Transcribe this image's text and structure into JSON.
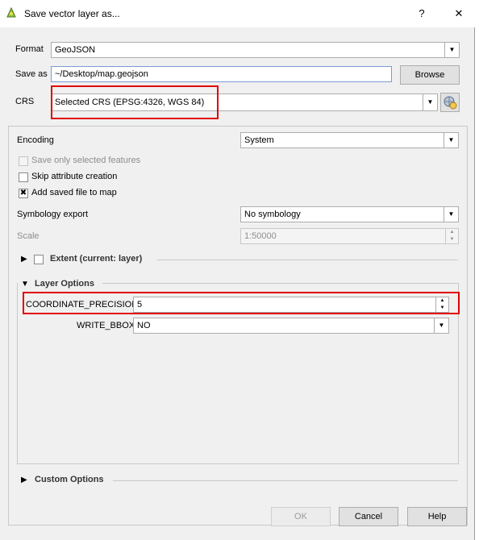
{
  "window": {
    "title": "Save vector layer as...",
    "help_label": "?",
    "close_label": "✕",
    "app_icon": "qgis-icon"
  },
  "format": {
    "label": "Format",
    "value": "GeoJSON"
  },
  "save_as": {
    "label": "Save as",
    "value": "~/Desktop/map.geojson",
    "browse_label": "Browse"
  },
  "crs": {
    "label": "CRS",
    "value": "Selected CRS (EPSG:4326, WGS 84)",
    "icon": "crs-globe-icon"
  },
  "encoding": {
    "label": "Encoding",
    "value": "System"
  },
  "checkboxes": {
    "save_selected": {
      "label": "Save only selected features",
      "checked": false,
      "enabled": false
    },
    "skip_attr": {
      "label": "Skip attribute creation",
      "checked": false,
      "enabled": true
    },
    "add_to_map": {
      "label": "Add saved file to map",
      "checked": true,
      "enabled": true,
      "mark": "✖"
    }
  },
  "symbology": {
    "label": "Symbology export",
    "value": "No symbology"
  },
  "scale": {
    "label": "Scale",
    "value": "1:50000"
  },
  "extent": {
    "label": "Extent (current: layer)"
  },
  "layer_options": {
    "label": "Layer Options",
    "coord_precision": {
      "label": "COORDINATE_PRECISION",
      "value": "5"
    },
    "write_bbox": {
      "label": "WRITE_BBOX",
      "value": "NO"
    }
  },
  "custom_options": {
    "label": "Custom Options"
  },
  "buttons": {
    "ok": "OK",
    "cancel": "Cancel",
    "help": "Help"
  },
  "icons": {
    "expand": "▶",
    "collapse": "▼",
    "dropdown": "▼",
    "spin_up": "▲",
    "spin_down": "▼"
  },
  "highlight_color": "#e00000"
}
